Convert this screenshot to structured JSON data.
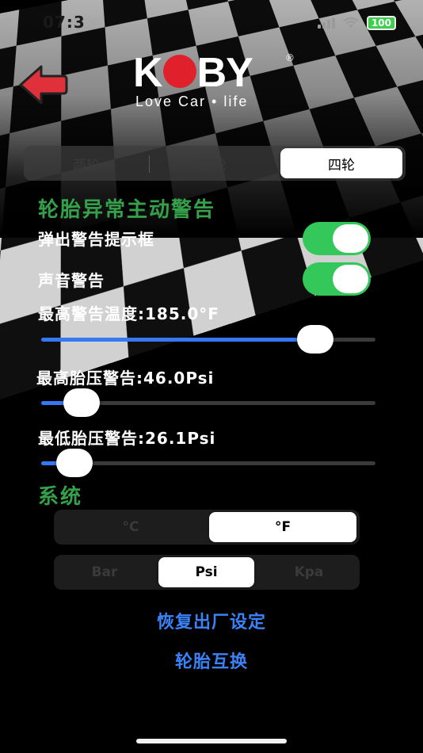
{
  "status_bar": {
    "time": "07:3",
    "battery": "100"
  },
  "header": {
    "logo_text_k": "K",
    "logo_text_rest": "BY",
    "logo_registered": "®",
    "tagline": "Love Car • life"
  },
  "wheel_tabs": {
    "items": [
      "两轮",
      "三轮",
      "四轮"
    ],
    "selected": "四轮"
  },
  "alerts": {
    "title": "轮胎异常主动警告",
    "popup_label": "弹出警告提示框",
    "popup_on": true,
    "sound_label": "声音警告",
    "sound_on": true,
    "max_temp_label": "最高警告温度:185.0°F",
    "max_temp_level": 0.82,
    "max_pressure_label": "最高胎压警告:46.0Psi",
    "max_pressure_level": 0.12,
    "min_pressure_label": "最低胎压警告:26.1Psi",
    "min_pressure_level": 0.1
  },
  "system": {
    "title": "系统",
    "temp_units": [
      "°C",
      "°F"
    ],
    "temp_selected": "°F",
    "pressure_units": [
      "Bar",
      "Psi",
      "Kpa"
    ],
    "pressure_selected": "Psi"
  },
  "actions": {
    "reset_label": "恢复出厂设定",
    "swap_label": "轮胎互换"
  },
  "colors": {
    "accent_green": "#35a04a",
    "toggle_green": "#34c759",
    "slider_blue": "#3478f6",
    "link_blue": "#3b82f6",
    "back_arrow_red": "#e0313a"
  }
}
